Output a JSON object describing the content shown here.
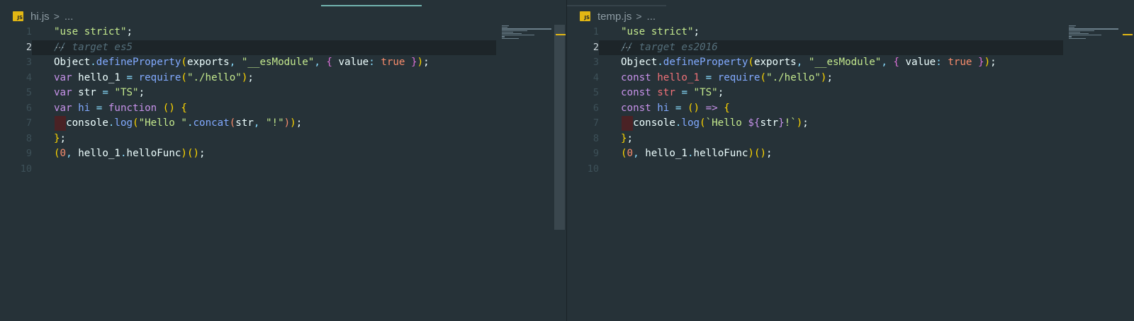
{
  "left": {
    "file": "hi.js",
    "icon_text": "JS",
    "ellipsis": "...",
    "lines": [
      {
        "n": "1",
        "html": "<span class=\"str\">\"use strict\"</span><span class=\"pl\">;</span>"
      },
      {
        "n": "2",
        "html": "<span class=\"cm\">// target es5</span>"
      },
      {
        "n": "3",
        "html": "<span class=\"pl\">Object</span><span class=\"pn\">.</span><span class=\"fn\">defineProperty</span><span class=\"b1\">(</span><span class=\"pl\">exports</span><span class=\"pn\">, </span><span class=\"str\">\"__esModule\"</span><span class=\"pn\">, </span><span class=\"b2\">{</span><span class=\"pl\"> value</span><span class=\"pn\">: </span><span class=\"num\">true</span><span class=\"b2\"> }</span><span class=\"b1\">)</span><span class=\"pl\">;</span>"
      },
      {
        "n": "4",
        "html": "<span class=\"kw\">var</span><span class=\"pl\"> hello_1 </span><span class=\"pn\">= </span><span class=\"fn\">require</span><span class=\"b1\">(</span><span class=\"str\">\"./hello\"</span><span class=\"b1\">)</span><span class=\"pl\">;</span>"
      },
      {
        "n": "5",
        "html": "<span class=\"kw\">var</span><span class=\"pl\"> str </span><span class=\"pn\">= </span><span class=\"str\">\"TS\"</span><span class=\"pl\">;</span>"
      },
      {
        "n": "6",
        "html": "<span class=\"kw\">var</span><span class=\"fn\"> hi </span><span class=\"pn\">= </span><span class=\"kw\">function</span><span class=\"b1\"> ()</span><span class=\"b1\"> {</span>"
      },
      {
        "n": "7",
        "html": "<span class=\"pl\">  console</span><span class=\"pn\">.</span><span class=\"fn\">log</span><span class=\"b1\">(</span><span class=\"str\">\"Hello \"</span><span class=\"pn\">.</span><span class=\"fn\">concat</span><span class=\"b3\">(</span><span class=\"pl\">str</span><span class=\"pn\">, </span><span class=\"str\">\"!\"</span><span class=\"b3\">)</span><span class=\"b1\">)</span><span class=\"pl\">;</span>"
      },
      {
        "n": "8",
        "html": "<span class=\"b1\">}</span><span class=\"pl\">;</span>"
      },
      {
        "n": "9",
        "html": "<span class=\"b1\">(</span><span class=\"num\">0</span><span class=\"pn\">, </span><span class=\"pl\">hello_1</span><span class=\"pn\">.</span><span class=\"pl\">helloFunc</span><span class=\"b1\">)</span><span class=\"b1\">()</span><span class=\"pl\">;</span>"
      },
      {
        "n": "10",
        "html": ""
      }
    ]
  },
  "right": {
    "file": "temp.js",
    "icon_text": "JS",
    "ellipsis": "...",
    "lines": [
      {
        "n": "1",
        "html": "<span class=\"str\">\"use strict\"</span><span class=\"pl\">;</span>"
      },
      {
        "n": "2",
        "html": "<span class=\"cm\">// target es2016</span>"
      },
      {
        "n": "3",
        "html": "<span class=\"pl\">Object</span><span class=\"pn\">.</span><span class=\"fn\">defineProperty</span><span class=\"b1\">(</span><span class=\"pl\">exports</span><span class=\"pn\">, </span><span class=\"str\">\"__esModule\"</span><span class=\"pn\">, </span><span class=\"b2\">{</span><span class=\"pl\"> value</span><span class=\"pn\">: </span><span class=\"num\">true</span><span class=\"b2\"> }</span><span class=\"b1\">)</span><span class=\"pl\">;</span>"
      },
      {
        "n": "4",
        "html": "<span class=\"kw\">const</span><span class=\"var\"> hello_1 </span><span class=\"pn\">= </span><span class=\"fn\">require</span><span class=\"b1\">(</span><span class=\"str\">\"./hello\"</span><span class=\"b1\">)</span><span class=\"pl\">;</span>"
      },
      {
        "n": "5",
        "html": "<span class=\"kw\">const</span><span class=\"var\"> str </span><span class=\"pn\">= </span><span class=\"str\">\"TS\"</span><span class=\"pl\">;</span>"
      },
      {
        "n": "6",
        "html": "<span class=\"kw\">const</span><span class=\"fn\"> hi </span><span class=\"pn\">= </span><span class=\"b1\">()</span><span class=\"kw\"> =&gt; </span><span class=\"b1\">{</span>"
      },
      {
        "n": "7",
        "html": "<span class=\"pl\">  console</span><span class=\"pn\">.</span><span class=\"fn\">log</span><span class=\"b1\">(</span><span class=\"str\">`Hello </span><span class=\"kw\">${</span><span class=\"pl\">str</span><span class=\"kw\">}</span><span class=\"str\">!`</span><span class=\"b1\">)</span><span class=\"pl\">;</span>"
      },
      {
        "n": "8",
        "html": "<span class=\"b1\">}</span><span class=\"pl\">;</span>"
      },
      {
        "n": "9",
        "html": "<span class=\"b1\">(</span><span class=\"num\">0</span><span class=\"pn\">, </span><span class=\"pl\">hello_1</span><span class=\"pn\">.</span><span class=\"pl\">helloFunc</span><span class=\"b1\">)</span><span class=\"b1\">()</span><span class=\"pl\">;</span>"
      },
      {
        "n": "10",
        "html": ""
      }
    ]
  },
  "active_line": "2",
  "colors": {
    "background": "#263238",
    "string": "#c3e88d",
    "keyword": "#c792ea",
    "function": "#82aaff",
    "comment": "#546e7a"
  }
}
